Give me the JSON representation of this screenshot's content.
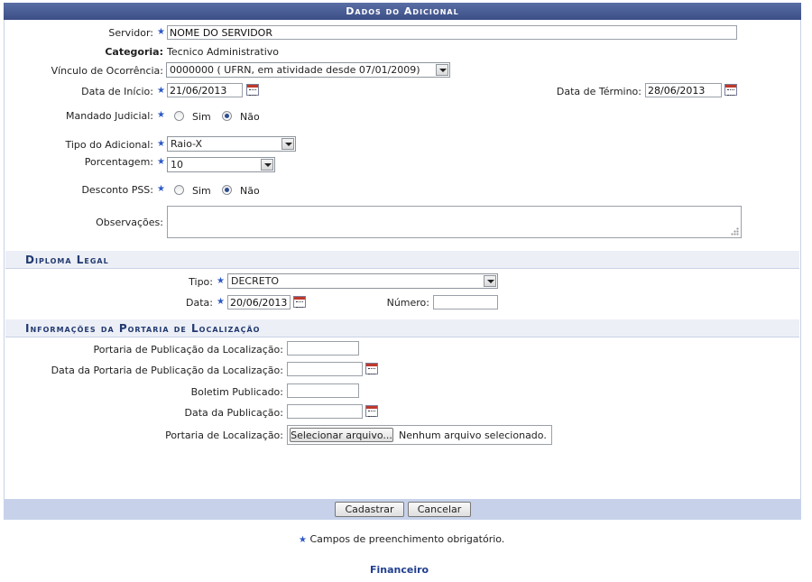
{
  "form": {
    "title": "Dados do Adicional",
    "servidor": {
      "label": "Servidor:",
      "value": "NOME DO SERVIDOR"
    },
    "categoria": {
      "label": "Categoria:",
      "value": "Tecnico Administrativo"
    },
    "vinculo": {
      "label": "Vínculo de Ocorrência:",
      "value": "0000000 ( UFRN, em atividade desde 07/01/2009)"
    },
    "data_inicio": {
      "label": "Data de Início:",
      "value": "21/06/2013"
    },
    "data_termino": {
      "label": "Data de Término:",
      "value": "28/06/2013"
    },
    "mandado": {
      "label": "Mandado Judicial:",
      "options": [
        "Sim",
        "Não"
      ],
      "selected": "Não"
    },
    "tipo_adicional": {
      "label": "Tipo do Adicional:",
      "value": "Raio-X"
    },
    "porcentagem": {
      "label": "Porcentagem:",
      "value": "10"
    },
    "desconto_pss": {
      "label": "Desconto PSS:",
      "options": [
        "Sim",
        "Não"
      ],
      "selected": "Não"
    },
    "observacoes": {
      "label": "Observações:",
      "value": ""
    }
  },
  "diploma": {
    "title": "Diploma Legal",
    "tipo": {
      "label": "Tipo:",
      "value": "DECRETO"
    },
    "data": {
      "label": "Data:",
      "value": "20/06/2013"
    },
    "numero": {
      "label": "Número:",
      "value": ""
    }
  },
  "portaria": {
    "title": "Informações da Portaria de Localização",
    "portaria_publicacao": {
      "label": "Portaria de Publicação da Localização:",
      "value": ""
    },
    "data_portaria": {
      "label": "Data da Portaria de Publicação da Localização:",
      "value": ""
    },
    "boletim": {
      "label": "Boletim Publicado:",
      "value": ""
    },
    "data_publicacao": {
      "label": "Data da Publicação:",
      "value": ""
    },
    "arquivo": {
      "label": "Portaria de Localização:",
      "button": "Selecionar arquivo...",
      "status": "Nenhum arquivo selecionado."
    }
  },
  "buttons": {
    "cadastrar": "Cadastrar",
    "cancelar": "Cancelar"
  },
  "footer": {
    "required_note": "Campos de preenchimento obrigatório.",
    "link": "Financeiro"
  },
  "colors": {
    "title_bar": "#3b4e86",
    "required_star": "#2c59c9",
    "section_bg": "#eceff6",
    "footer_bar": "#c7d2ea"
  }
}
